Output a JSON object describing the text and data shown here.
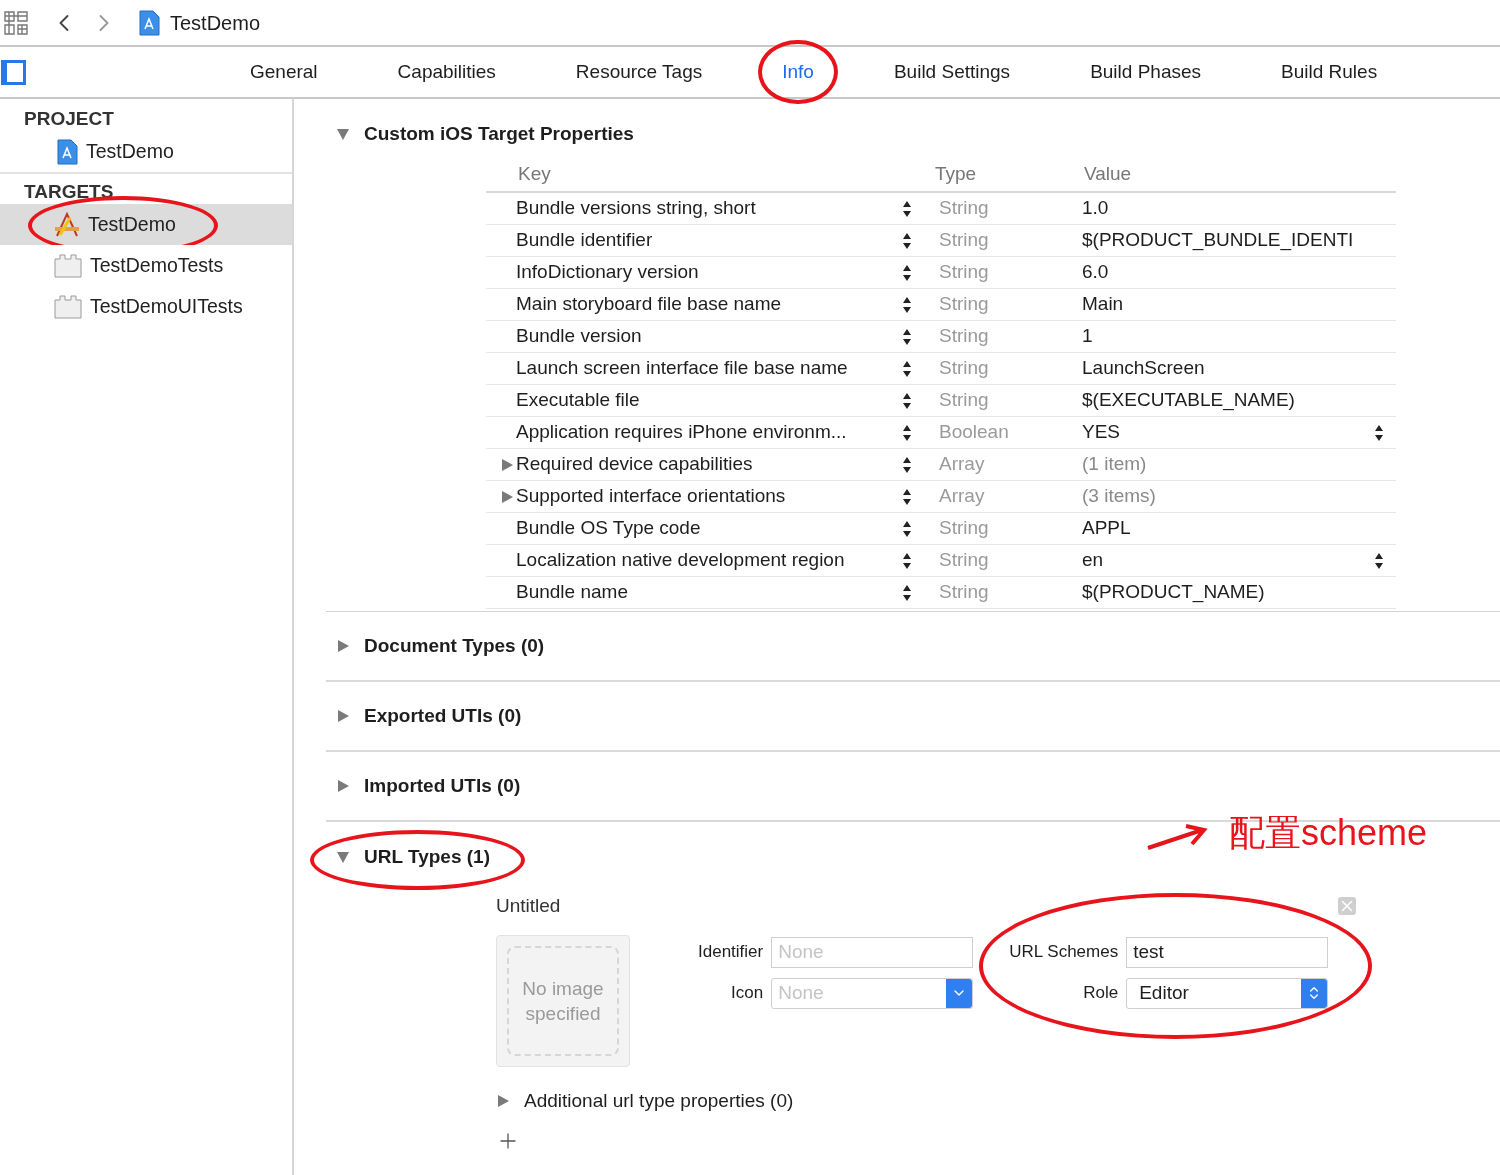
{
  "toolbar": {
    "title": "TestDemo"
  },
  "tabs": [
    {
      "label": "General",
      "selected": false
    },
    {
      "label": "Capabilities",
      "selected": false
    },
    {
      "label": "Resource Tags",
      "selected": false
    },
    {
      "label": "Info",
      "selected": true,
      "annotated": true
    },
    {
      "label": "Build Settings",
      "selected": false
    },
    {
      "label": "Build Phases",
      "selected": false
    },
    {
      "label": "Build Rules",
      "selected": false
    }
  ],
  "sidebar": {
    "sections": [
      {
        "heading": "PROJECT",
        "items": [
          {
            "label": "TestDemo",
            "kind": "project",
            "selected": false,
            "annotated": false
          }
        ]
      },
      {
        "heading": "TARGETS",
        "items": [
          {
            "label": "TestDemo",
            "kind": "app",
            "selected": true,
            "annotated": true
          },
          {
            "label": "TestDemoTests",
            "kind": "bundle",
            "selected": false,
            "annotated": false
          },
          {
            "label": "TestDemoUITests",
            "kind": "bundle",
            "selected": false,
            "annotated": false
          }
        ]
      }
    ]
  },
  "properties": {
    "title": "Custom iOS Target Properties",
    "expanded": true,
    "columns": [
      "Key",
      "Type",
      "Value"
    ],
    "rows": [
      {
        "key": "Bundle versions string, short",
        "type": "String",
        "value": "1.0",
        "kind": "plain",
        "popup": false
      },
      {
        "key": "Bundle identifier",
        "type": "String",
        "value": "$(PRODUCT_BUNDLE_IDENTI",
        "kind": "plain",
        "popup": false
      },
      {
        "key": "InfoDictionary version",
        "type": "String",
        "value": "6.0",
        "kind": "plain",
        "popup": false
      },
      {
        "key": "Main storyboard file base name",
        "type": "String",
        "value": "Main",
        "kind": "plain",
        "popup": false
      },
      {
        "key": "Bundle version",
        "type": "String",
        "value": "1",
        "kind": "plain",
        "popup": false
      },
      {
        "key": "Launch screen interface file base name",
        "type": "String",
        "value": "LaunchScreen",
        "kind": "plain",
        "popup": false
      },
      {
        "key": "Executable file",
        "type": "String",
        "value": "$(EXECUTABLE_NAME)",
        "kind": "plain",
        "popup": false
      },
      {
        "key": "Application requires iPhone environm...",
        "type": "Boolean",
        "value": "YES",
        "kind": "plain",
        "popup": true
      },
      {
        "key": "Required device capabilities",
        "type": "Array",
        "value": "(1 item)",
        "kind": "collection",
        "popup": false
      },
      {
        "key": "Supported interface orientations",
        "type": "Array",
        "value": "(3 items)",
        "kind": "collection",
        "popup": false
      },
      {
        "key": "Bundle OS Type code",
        "type": "String",
        "value": "APPL",
        "kind": "plain",
        "popup": false
      },
      {
        "key": "Localization native development region",
        "type": "String",
        "value": "en",
        "kind": "plain",
        "popup": true
      },
      {
        "key": "Bundle name",
        "type": "String",
        "value": "$(PRODUCT_NAME)",
        "kind": "plain",
        "popup": false
      }
    ]
  },
  "collapsed_sections": [
    {
      "title": "Document Types (0)",
      "expanded": false
    },
    {
      "title": "Exported UTIs (0)",
      "expanded": false
    },
    {
      "title": "Imported UTIs (0)",
      "expanded": false
    }
  ],
  "url_types": {
    "title": "URL Types (1)",
    "expanded": true,
    "entry": {
      "name": "Untitled",
      "image_text": "No image specified",
      "identifier_label": "Identifier",
      "identifier_placeholder": "None",
      "icon_label": "Icon",
      "icon_placeholder": "None",
      "schemes_label": "URL Schemes",
      "schemes_value": "test",
      "role_label": "Role",
      "role_value": "Editor",
      "additional": "Additional url type properties (0)",
      "additional_expanded": false
    }
  },
  "annotation": {
    "text": "配置scheme"
  }
}
